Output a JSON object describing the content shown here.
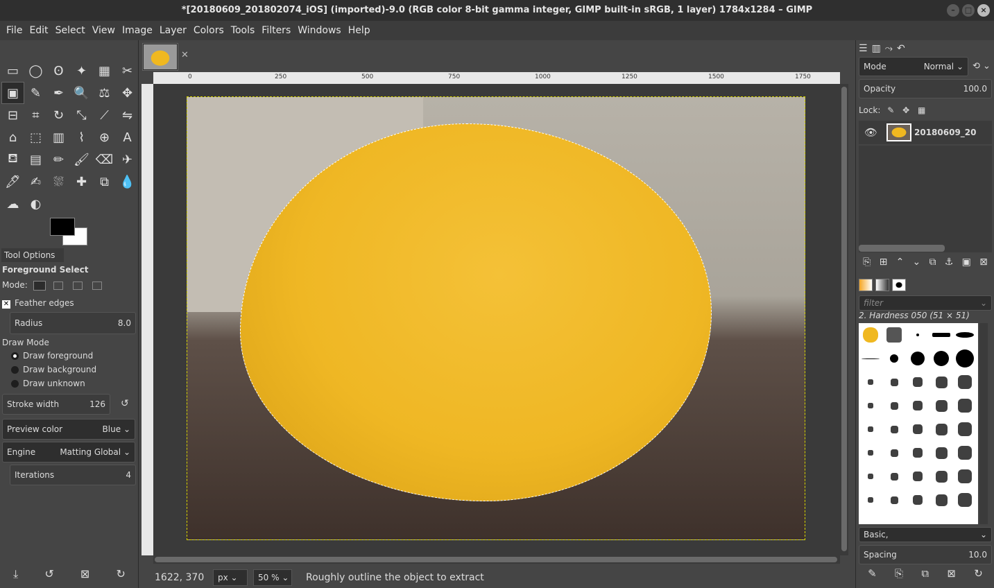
{
  "window": {
    "title": "*[20180609_201802074_iOS] (imported)-9.0 (RGB color 8-bit gamma integer, GIMP built-in sRGB, 1 layer) 1784x1284 – GIMP"
  },
  "menu": {
    "items": [
      "File",
      "Edit",
      "Select",
      "View",
      "Image",
      "Layer",
      "Colors",
      "Tools",
      "Filters",
      "Windows",
      "Help"
    ]
  },
  "toolbox": {
    "tools": [
      "rect-select-icon",
      "ellipse-select-icon",
      "free-select-icon",
      "fuzzy-select-icon",
      "color-select-icon",
      "scissors-select-icon",
      "foreground-select-icon",
      "paths-icon",
      "color-picker-icon",
      "zoom-icon",
      "measure-icon",
      "move-icon",
      "align-icon",
      "crop-icon",
      "rotate-icon",
      "scale-icon",
      "shear-icon",
      "flip-icon",
      "cage-icon",
      "perspective-icon",
      "3d-transform-icon",
      "warp-icon",
      "unified-transform-icon",
      "text-icon",
      "bucket-fill-icon",
      "gradient-icon",
      "pencil-icon",
      "paintbrush-icon",
      "eraser-icon",
      "airbrush-icon",
      "ink-icon",
      "mypaint-brush-icon",
      "clone-icon",
      "heal-icon",
      "perspective-clone-icon",
      "blur-icon",
      "smudge-icon",
      "dodge-burn-icon"
    ],
    "glyphs": [
      "▭",
      "◯",
      "ʘ",
      "✦",
      "▦",
      "✂",
      "▣",
      "✎",
      "✒",
      "🔍",
      "⚖",
      "✥",
      "⊟",
      "⌗",
      "↻",
      "⤡",
      "⟋",
      "⇋",
      "⌂",
      "⬚",
      "▥",
      "⌇",
      "⊕",
      "A",
      "⛾",
      "▤",
      "✏",
      "🖌",
      "⌫",
      "✈",
      "🖋",
      "✍",
      "⛆",
      "✚",
      "⧉",
      "💧",
      "☁",
      "◐"
    ],
    "foreground_color": "#000000",
    "background_color": "#ffffff"
  },
  "tool_options": {
    "tab_label": "Tool Options",
    "title": "Foreground Select",
    "mode_label": "Mode:",
    "feather_label": "Feather edges",
    "radius_label": "Radius",
    "radius_value": "8.0",
    "draw_mode_label": "Draw Mode",
    "draw_modes": [
      "Draw foreground",
      "Draw background",
      "Draw unknown"
    ],
    "stroke_label": "Stroke width",
    "stroke_value": "126",
    "preview_label": "Preview color",
    "preview_value": "Blue",
    "engine_label": "Engine",
    "engine_value": "Matting Global",
    "iterations_label": "Iterations",
    "iterations_value": "4"
  },
  "ruler": {
    "ticks": [
      "0",
      "250",
      "500",
      "750",
      "1000",
      "1250",
      "1500",
      "1750"
    ]
  },
  "status": {
    "coords": "1622, 370",
    "unit": "px",
    "zoom": "50 %",
    "message": "Roughly outline the object to extract"
  },
  "layers": {
    "mode_label": "Mode",
    "mode_value": "Normal",
    "opacity_label": "Opacity",
    "opacity_value": "100.0",
    "lock_label": "Lock:",
    "layer_name": "20180609_20"
  },
  "brushes": {
    "filter_placeholder": "filter",
    "selected_brush": "2. Hardness 050 (51 × 51)",
    "tag_value": "Basic,",
    "spacing_label": "Spacing",
    "spacing_value": "10.0"
  }
}
